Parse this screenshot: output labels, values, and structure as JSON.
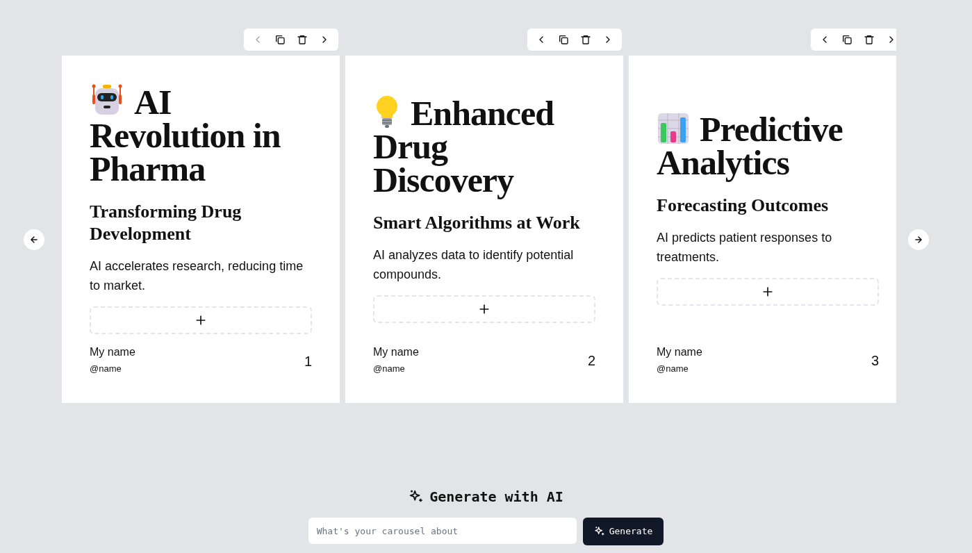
{
  "carousel": {
    "slides": [
      {
        "toolbar": {
          "prev_disabled": true,
          "next_disabled": false
        },
        "title": "AI Revolution in Pharma",
        "subtitle": "Transforming Drug Development",
        "body": "AI accelerates research, reducing time to market.",
        "author_name": "My name",
        "author_handle": "@name",
        "page_number": "1"
      },
      {
        "toolbar": {
          "prev_disabled": false,
          "next_disabled": false
        },
        "title": "Enhanced Drug Discovery",
        "subtitle": "Smart Algorithms at Work",
        "body": "AI analyzes data to identify potential compounds.",
        "author_name": "My name",
        "author_handle": "@name",
        "page_number": "2"
      },
      {
        "toolbar": {
          "prev_disabled": false,
          "next_disabled": false
        },
        "title": "Predictive Analytics",
        "subtitle": "Forecasting Outcomes",
        "body": "AI predicts patient responses to treatments.",
        "author_name": "My name",
        "author_handle": "@name",
        "page_number": "3"
      }
    ]
  },
  "generate": {
    "heading": "Generate with AI",
    "placeholder": "What's your carousel about",
    "button": "Generate"
  }
}
